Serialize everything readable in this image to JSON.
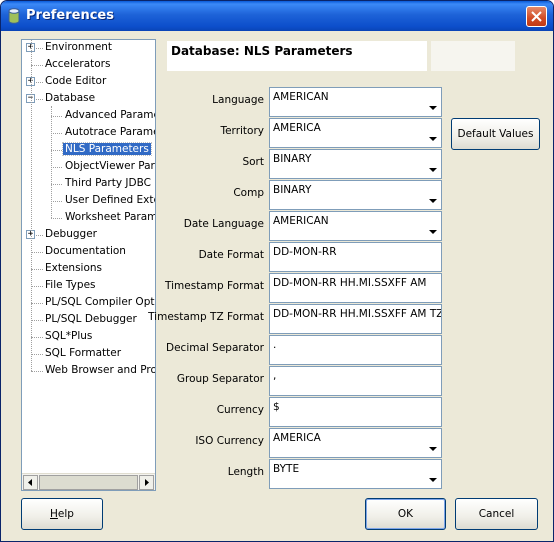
{
  "window": {
    "title": "Preferences",
    "icon": "app-cylinder-icon",
    "close_icon": "close-icon"
  },
  "tree": {
    "items": [
      {
        "label": "Environment",
        "expander": "+"
      },
      {
        "label": "Accelerators",
        "expander": ""
      },
      {
        "label": "Code Editor",
        "expander": "+"
      },
      {
        "label": "Database",
        "expander": "−"
      },
      {
        "label": "Advanced Paramet",
        "expander": ""
      },
      {
        "label": "Autotrace Paramet",
        "expander": ""
      },
      {
        "label": "NLS Parameters",
        "expander": ""
      },
      {
        "label": "ObjectViewer Para",
        "expander": ""
      },
      {
        "label": "Third Party JDBC D",
        "expander": ""
      },
      {
        "label": "User Defined Exter",
        "expander": ""
      },
      {
        "label": "Worksheet Parame",
        "expander": ""
      },
      {
        "label": "Debugger",
        "expander": "+"
      },
      {
        "label": "Documentation",
        "expander": ""
      },
      {
        "label": "Extensions",
        "expander": ""
      },
      {
        "label": "File Types",
        "expander": ""
      },
      {
        "label": "PL/SQL Compiler Option",
        "expander": ""
      },
      {
        "label": "PL/SQL Debugger",
        "expander": ""
      },
      {
        "label": "SQL*Plus",
        "expander": ""
      },
      {
        "label": "SQL Formatter",
        "expander": ""
      },
      {
        "label": "Web Browser and Pro",
        "expander": ""
      }
    ],
    "selected": "NLS Parameters"
  },
  "panel": {
    "title": "Database: NLS Parameters"
  },
  "fields": [
    {
      "label": "Language",
      "value": "AMERICAN",
      "kind": "combo"
    },
    {
      "label": "Territory",
      "value": "AMERICA",
      "kind": "combo"
    },
    {
      "label": "Sort",
      "value": "BINARY",
      "kind": "combo"
    },
    {
      "label": "Comp",
      "value": "BINARY",
      "kind": "combo"
    },
    {
      "label": "Date Language",
      "value": "AMERICAN",
      "kind": "combo"
    },
    {
      "label": "Date Format",
      "value": "DD-MON-RR",
      "kind": "text"
    },
    {
      "label": "Timestamp Format",
      "value": "DD-MON-RR HH.MI.SSXFF AM",
      "kind": "text"
    },
    {
      "label": "Timestamp TZ Format",
      "value": "DD-MON-RR HH.MI.SSXFF AM TZR",
      "kind": "text"
    },
    {
      "label": "Decimal Separator",
      "value": ".",
      "kind": "text"
    },
    {
      "label": "Group Separator",
      "value": ",",
      "kind": "text"
    },
    {
      "label": "Currency",
      "value": "$",
      "kind": "text"
    },
    {
      "label": "ISO Currency",
      "value": "AMERICA",
      "kind": "combo"
    },
    {
      "label": "Length",
      "value": "BYTE",
      "kind": "combo"
    }
  ],
  "buttons": {
    "default_values": "Default Values",
    "help_underlined": "H",
    "help_rest": "elp",
    "ok": "OK",
    "cancel": "Cancel"
  },
  "colors": {
    "title_bar": "#0c4ecb",
    "selection": "#316ac5",
    "dialog_bg": "#ece9d8"
  }
}
